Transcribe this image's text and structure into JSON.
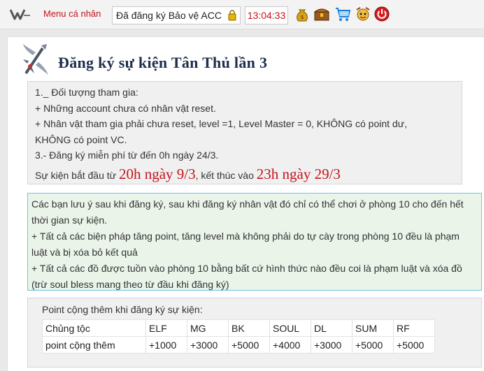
{
  "topbar": {
    "menu_label": "Menu cá nhân",
    "status_text": "Đã đăng ký Bảo vệ ACC",
    "clock": "13:04:33",
    "icons": [
      "money-bag-icon",
      "treasure-chest-icon",
      "shopping-cart-icon",
      "character-face-icon",
      "power-icon"
    ]
  },
  "page": {
    "title": "Đăng ký sự kiện Tân Thủ lần 3"
  },
  "info": {
    "lines": [
      "1._ Đối tượng tham gia:",
      "+ Những account chưa có nhân vật reset.",
      "+ Nhân vật tham gia phải chưa reset, level =1, Level Master = 0, KHÔNG có point dư,",
      "KHÔNG có point VC.",
      "3.- Đăng ký miễn phí từ đến 0h ngày 24/3."
    ],
    "event_prefix": "Sự kiện bắt đầu từ",
    "event_start": "20h ngày 9/3",
    "event_middle": ", kết thúc vào",
    "event_end": "23h ngày 29/3"
  },
  "notice": {
    "p1": "Các bạn lưu ý sau khi đăng ký, sau khi đăng ký nhân vật đó chỉ có thể chơi ở phòng 10 cho đến hết thời gian sự kiện.",
    "p2": "+ Tất cả các biện pháp tăng point, tăng level mà không phải do tự cày trong phòng 10 đều là phạm luật và bị xóa bỏ kết quả",
    "p3": "+ Tất cả các đồ được tuồn vào phòng 10 bằng bất cứ hình thức nào đều coi là phạm luật và xóa đồ (trừ soul bless mang theo từ đầu khi đăng ký)"
  },
  "points": {
    "caption": "Point cộng thêm khi đăng ký sự kiện:",
    "header": [
      "Chủng tộc",
      "ELF",
      "MG",
      "BK",
      "SOUL",
      "DL",
      "SUM",
      "RF"
    ],
    "row": [
      "point cộng thêm",
      "+1000",
      "+3000",
      "+5000",
      "+4000",
      "+3000",
      "+5000",
      "+5000"
    ]
  },
  "colors": {
    "accent_red": "#c4141b",
    "title_navy": "#1d2f4d",
    "notice_border": "#6fc6e0",
    "notice_bg": "#eaf4e9"
  }
}
